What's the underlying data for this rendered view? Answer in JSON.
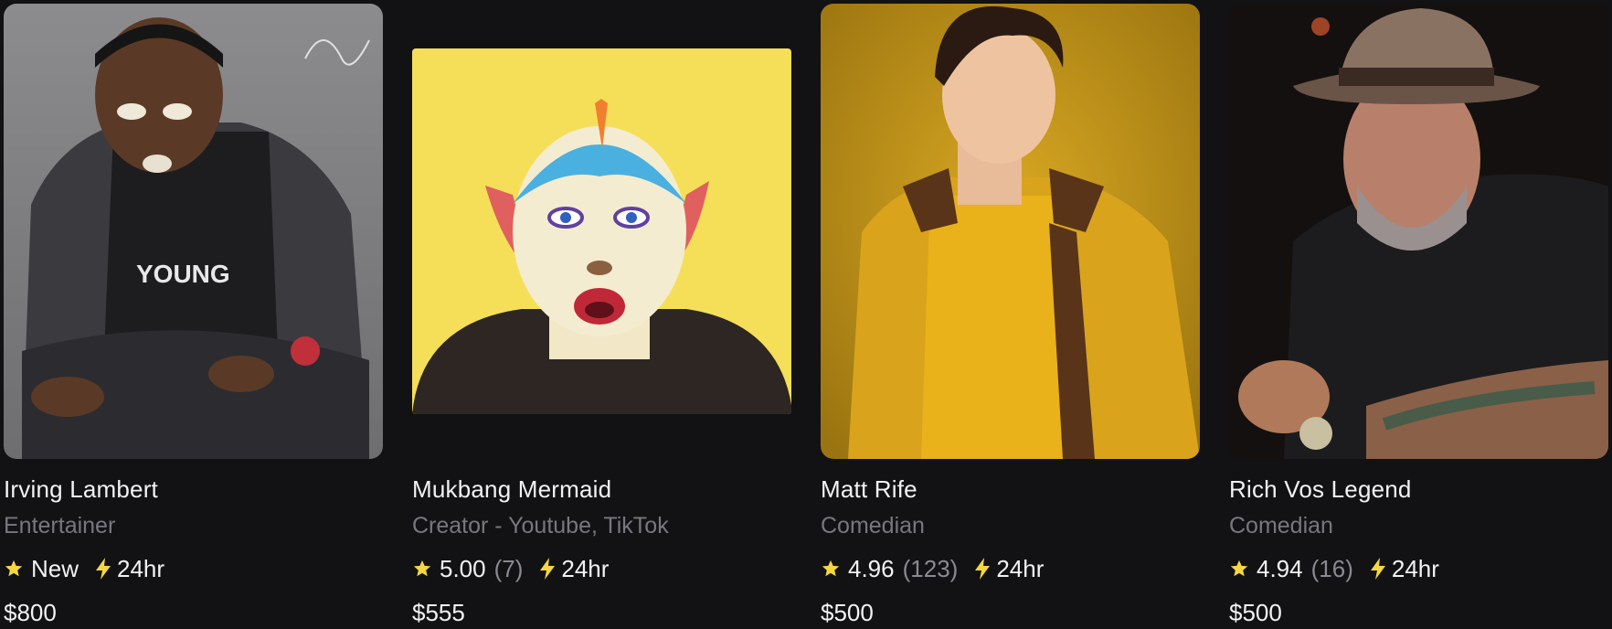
{
  "cards": [
    {
      "name": "Irving Lambert",
      "category": "Entertainer",
      "rating": "New",
      "reviews": "",
      "response": "24hr",
      "price": "$800"
    },
    {
      "name": "Mukbang Mermaid",
      "category": "Creator - Youtube, TikTok",
      "rating": "5.00",
      "reviews": "(7)",
      "response": "24hr",
      "price": "$555"
    },
    {
      "name": "Matt Rife",
      "category": "Comedian",
      "rating": "4.96",
      "reviews": "(123)",
      "response": "24hr",
      "price": "$500"
    },
    {
      "name": "Rich Vos Legend",
      "category": "Comedian",
      "rating": "4.94",
      "reviews": "(16)",
      "response": "24hr",
      "price": "$500"
    }
  ],
  "colors": {
    "background": "#121215",
    "star": "#f5d742",
    "bolt": "#f5d742",
    "muted_text": "#77777f"
  },
  "icons": [
    "star-icon",
    "lightning-icon"
  ]
}
